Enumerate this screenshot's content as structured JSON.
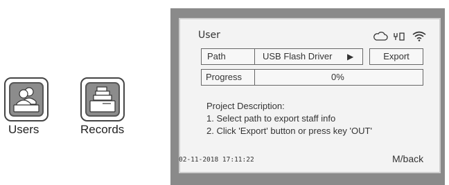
{
  "launcher": {
    "apps": [
      {
        "label": "Users",
        "icon": "users-icon"
      },
      {
        "label": "Records",
        "icon": "records-icon"
      }
    ]
  },
  "screen": {
    "title": "User",
    "status_icons": [
      "cloud-icon",
      "usb-icon",
      "wifi-icon"
    ],
    "path": {
      "label": "Path",
      "value": "USB Flash Driver",
      "arrow": "▶"
    },
    "export_label": "Export",
    "progress": {
      "label": "Progress",
      "value": "0%",
      "fraction": 0
    },
    "description": {
      "heading": "Project Description:",
      "lines": [
        "1. Select path to export staff info",
        "2. Click 'Export' button or press key 'OUT'"
      ]
    },
    "datetime": "02-11-2018  17:11:22",
    "back_label": "M/back"
  }
}
